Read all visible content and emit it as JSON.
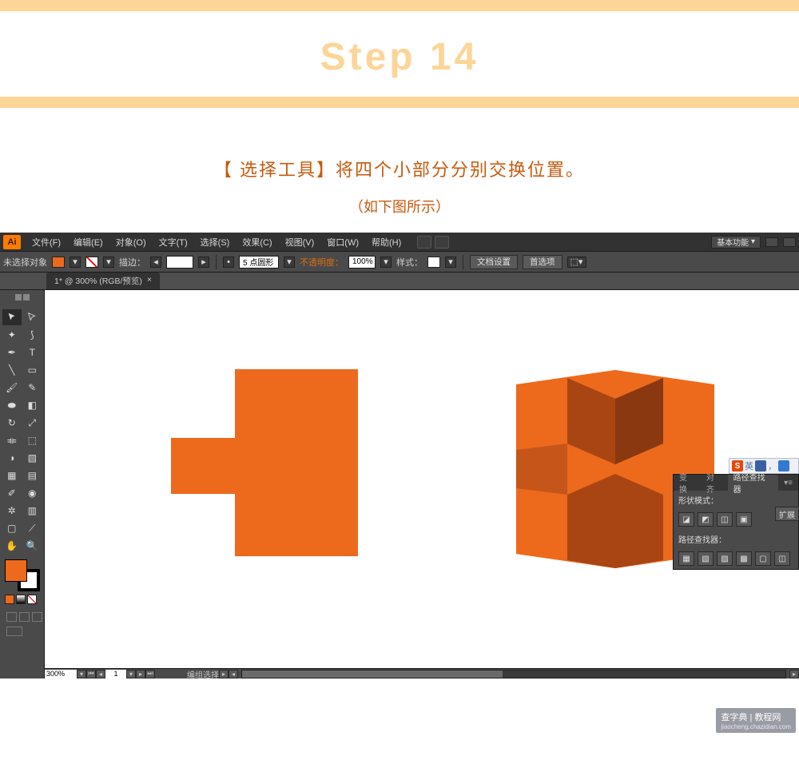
{
  "header": {
    "step_label": "Step 14",
    "instruction_main": "【 选择工具】将四个小部分分别交换位置。",
    "instruction_sub": "（如下图所示）"
  },
  "app": {
    "logo": "Ai",
    "menu": {
      "file": "文件(F)",
      "edit": "编辑(E)",
      "object": "对象(O)",
      "type": "文字(T)",
      "select": "选择(S)",
      "effect": "效果(C)",
      "view": "视图(V)",
      "window": "窗口(W)",
      "help": "帮助(H)"
    },
    "top_right": {
      "essentials": "基本功能",
      "min": "–"
    },
    "control_bar": {
      "no_selection": "未选择对象",
      "stroke_label": "描边：",
      "stroke_weight": "",
      "corner": "5 点圆形",
      "opacity_label": "不透明度：",
      "opacity_value": "100%",
      "style_label": "样式：",
      "doc_setup": "文档设置",
      "preferences": "首选项"
    },
    "document_tab": {
      "name": "1* @ 300% (RGB/预览)",
      "close": "×"
    },
    "panel": {
      "tab_transform": "变换",
      "tab_align": "对齐",
      "tab_pathfinder": "路径查找器",
      "shape_modes": "形状模式：",
      "pathfinders": "路径查找器：",
      "expand": "扩展"
    },
    "ime": {
      "s": "S",
      "lang": "英"
    },
    "status": {
      "zoom": "300%",
      "page": "1",
      "tool_name": "编组选择"
    },
    "colors": {
      "orange_main": "#ed6a1d",
      "orange_dark": "#b94e16",
      "orange_darker": "#8f3d13"
    }
  },
  "watermark": {
    "line1": "查字典 | 教程网",
    "line2": "jiaocheng.chazidian.com"
  },
  "chart_data": {
    "type": "diagram",
    "description": "Adobe Illustrator canvas showing two orange shapes: left flat cross/T shape, right 3D extruded H-like block",
    "shapes": [
      {
        "id": "left-flat-shape",
        "color": "#ed6a1d",
        "type": "flat-polygon"
      },
      {
        "id": "right-3d-shape",
        "colors": [
          "#ed6a1d",
          "#b94e16",
          "#8f3d13"
        ],
        "type": "3d-extrusion"
      }
    ]
  }
}
